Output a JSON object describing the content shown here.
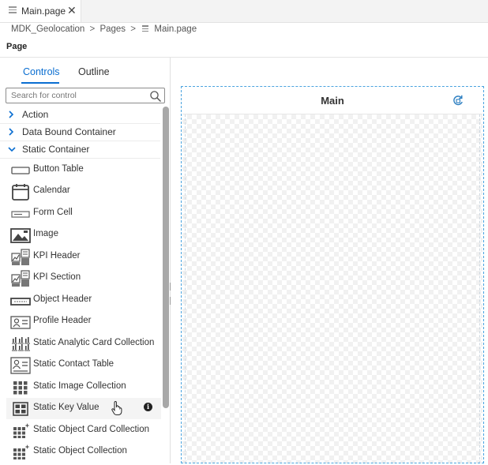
{
  "editor_tab": {
    "label": "Main.page",
    "close": "✕"
  },
  "breadcrumb": {
    "project": "MDK_Geolocation",
    "sep": ">",
    "folder": "Pages",
    "file": "Main.page"
  },
  "page_label": "Page",
  "left_tabs": {
    "controls": "Controls",
    "outline": "Outline",
    "active": "Controls"
  },
  "search": {
    "placeholder": "Search for control",
    "value": ""
  },
  "groups": [
    {
      "label": "Action",
      "expanded": false
    },
    {
      "label": "Data Bound Container",
      "expanded": false
    },
    {
      "label": "Static Container",
      "expanded": true
    }
  ],
  "items": [
    {
      "label": "Button Table",
      "icon": "button-table-icon"
    },
    {
      "label": "Calendar",
      "icon": "calendar-icon"
    },
    {
      "label": "Form Cell",
      "icon": "form-cell-icon"
    },
    {
      "label": "Image",
      "icon": "image-icon"
    },
    {
      "label": "KPI Header",
      "icon": "kpi-header-icon"
    },
    {
      "label": "KPI Section",
      "icon": "kpi-section-icon"
    },
    {
      "label": "Object Header",
      "icon": "object-header-icon"
    },
    {
      "label": "Profile Header",
      "icon": "profile-header-icon"
    },
    {
      "label": "Static Analytic Card Collection",
      "icon": "analytic-card-icon"
    },
    {
      "label": "Static Contact Table",
      "icon": "contact-table-icon"
    },
    {
      "label": "Static Image Collection",
      "icon": "image-collection-icon"
    },
    {
      "label": "Static Key Value",
      "icon": "key-value-icon",
      "hovered": true,
      "info": "i"
    },
    {
      "label": "Static Object Card Collection",
      "icon": "object-card-icon"
    },
    {
      "label": "Static Object Collection",
      "icon": "object-collection-icon"
    }
  ],
  "canvas": {
    "title": "Main"
  },
  "colors": {
    "accent": "#0a6ed1",
    "canvas_border": "#4aa3df"
  }
}
